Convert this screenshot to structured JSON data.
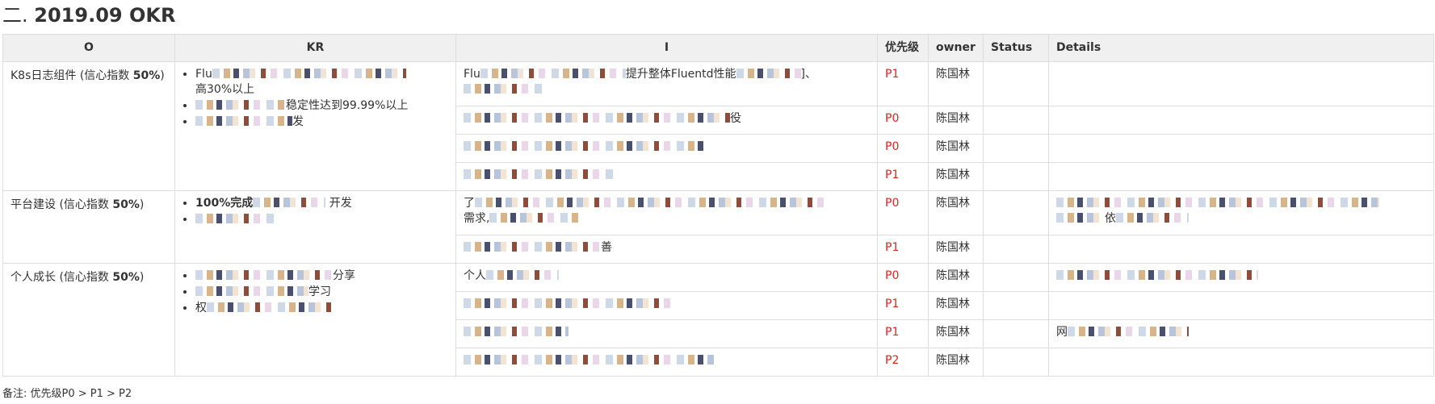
{
  "page": {
    "title_prefix": "二.",
    "title_main": "2019.09 OKR"
  },
  "table": {
    "headers": {
      "o": "O",
      "kr": "KR",
      "i": "I",
      "priority": "优先级",
      "owner": "owner",
      "status": "Status",
      "details": "Details"
    },
    "groups": [
      {
        "objective": "K8s日志组件 (信心指数 ",
        "confidence": "50%",
        "objective_close": ")",
        "krs": [
          {
            "text": "Flu",
            "tail": "高30%以上"
          },
          {
            "text": "",
            "tail": "稳定性达到99.99%以上"
          },
          {
            "text": "",
            "tail": "发"
          }
        ],
        "rows": [
          {
            "i_start": "Flu",
            "i_end": "提升整体Fluentd性能",
            "i_tail": "]、",
            "priority": "P1",
            "owner": "陈国林",
            "details": ""
          },
          {
            "i_start": "",
            "i_end": "役",
            "priority": "P0",
            "owner": "陈国林",
            "details": ""
          },
          {
            "i_start": "",
            "i_end": "",
            "priority": "P0",
            "owner": "陈国林",
            "details": ""
          },
          {
            "i_start": "",
            "i_end": "",
            "priority": "P1",
            "owner": "陈国林",
            "details": ""
          }
        ]
      },
      {
        "objective": "平台建设 (信心指数 ",
        "confidence": "50%",
        "objective_close": ")",
        "krs": [
          {
            "text": "100%完成",
            "tail": "开发"
          },
          {
            "text": "",
            "tail": ""
          }
        ],
        "rows": [
          {
            "i_start": "了",
            "i_end": "需求,",
            "priority": "P0",
            "owner": "陈国林",
            "details": "依"
          },
          {
            "i_start": "",
            "i_end": "善",
            "priority": "P1",
            "owner": "陈国林",
            "details": ""
          }
        ]
      },
      {
        "objective": "个人成长 (信心指数 ",
        "confidence": "50%",
        "objective_close": ")",
        "krs": [
          {
            "text": "",
            "tail": "分享"
          },
          {
            "text": "",
            "tail": "学习"
          },
          {
            "text": "权",
            "tail": ""
          }
        ],
        "rows": [
          {
            "i_start": "个人",
            "i_end": "",
            "priority": "P0",
            "owner": "陈国林",
            "details": ""
          },
          {
            "i_start": "",
            "i_end": "",
            "priority": "P1",
            "owner": "陈国林",
            "details": ""
          },
          {
            "i_start": "",
            "i_end": "",
            "priority": "P1",
            "owner": "陈国林",
            "details": "网"
          },
          {
            "i_start": "",
            "i_end": "",
            "priority": "P2",
            "owner": "陈国林",
            "details": ""
          }
        ]
      }
    ]
  },
  "footer": {
    "note": "备注: 优先级P0 > P1 > P2"
  }
}
